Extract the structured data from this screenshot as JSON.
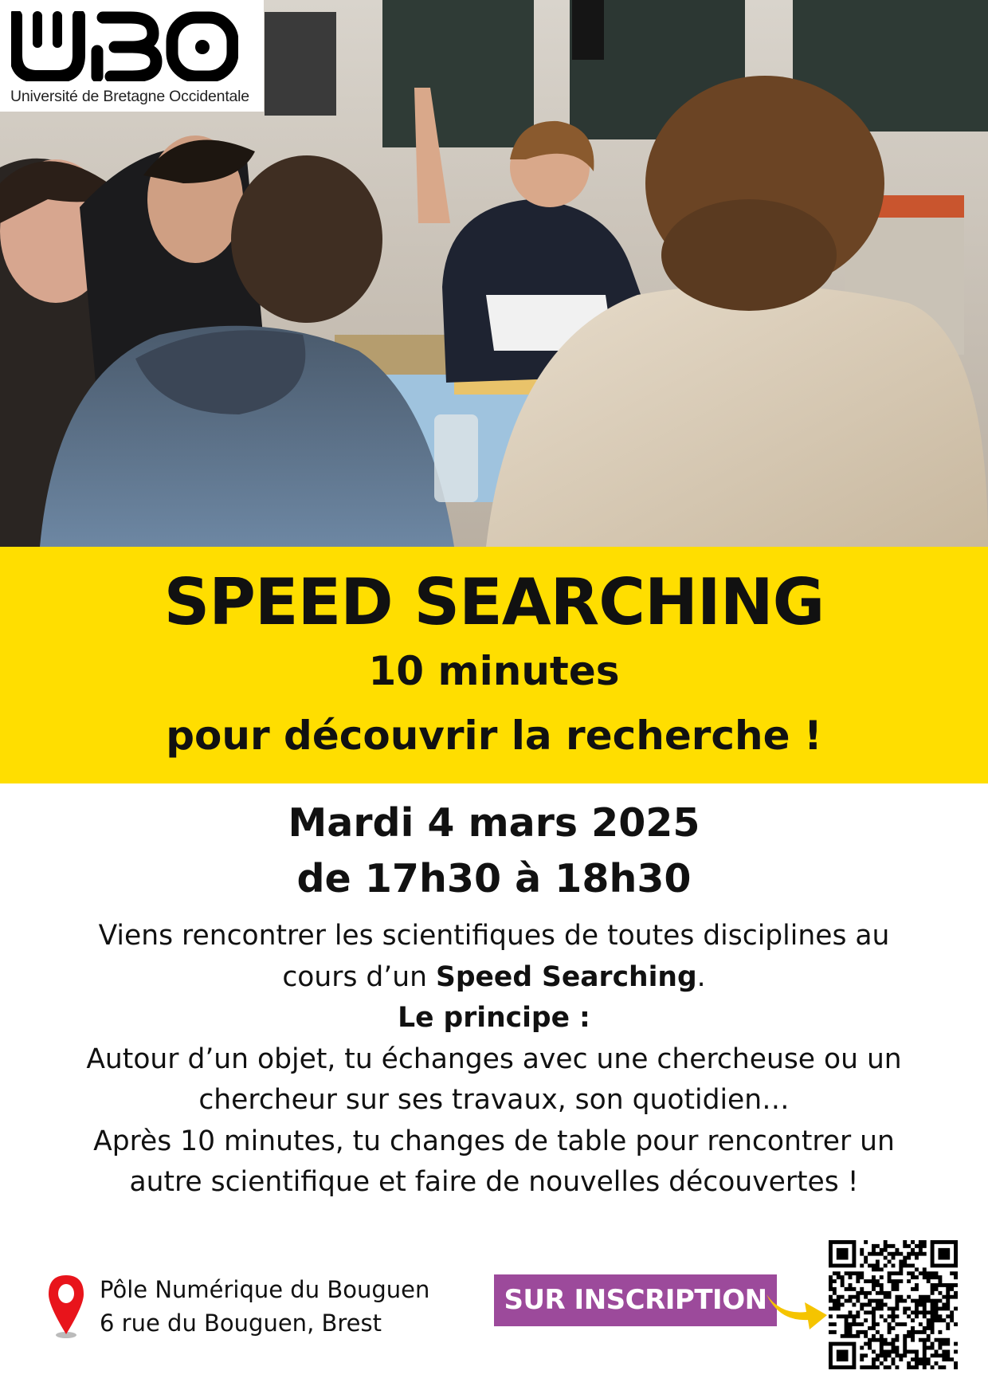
{
  "logo": {
    "mark": "UBO",
    "subtitle": "Université de Bretagne Occidentale"
  },
  "headline": {
    "title": "SPEED SEARCHING",
    "line1": "10 minutes",
    "line2": "pour découvrir la recherche !"
  },
  "event": {
    "date": "Mardi 4 mars 2025",
    "time": "de 17h30 à 18h30"
  },
  "description": {
    "line1": "Viens rencontrer les scientifiques de toutes disciplines au",
    "line2_pre": "cours d’un ",
    "line2_bold": "Speed Searching",
    "line2_post": ".",
    "principle_label": "Le principe :",
    "line4": "Autour d’un objet, tu échanges avec une chercheuse ou un",
    "line5": "chercheur sur ses travaux, son quotidien…",
    "line6": "Après 10 minutes, tu changes de table pour rencontrer un",
    "line7": "autre scientifique et faire de nouvelles découvertes !"
  },
  "location": {
    "icon": "map-pin-icon",
    "line1": "Pôle Numérique du Bouguen",
    "line2": "6 rue du Bouguen, Brest"
  },
  "registration": {
    "label": "SUR INSCRIPTION",
    "icon": "curved-arrow-icon"
  },
  "colors": {
    "band": "#FFDE00",
    "cta": "#9C4A9B",
    "pin": "#E8141B",
    "arrow": "#F5C400"
  }
}
